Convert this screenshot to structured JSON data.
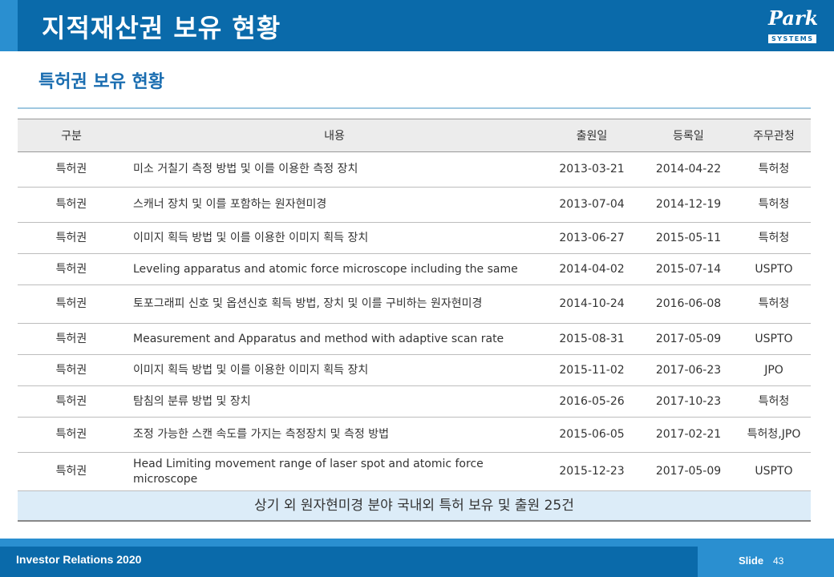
{
  "header": {
    "title": "지적재산권 보유 현황",
    "logo": {
      "word": "Park",
      "sub": "SYSTEMS"
    }
  },
  "section": {
    "title": "특허권 보유 현황"
  },
  "table": {
    "columns": [
      "구분",
      "내용",
      "출원일",
      "등록일",
      "주무관청"
    ],
    "rows": [
      {
        "type": "특허권",
        "content": "미소 거칠기 측정 방법 및 이를 이용한 측정 장치",
        "filed": "2013-03-21",
        "registered": "2014-04-22",
        "authority": "특허청"
      },
      {
        "type": "특허권",
        "content": "스캐너 장치 및 이를 포함하는 원자현미경",
        "filed": "2013-07-04",
        "registered": "2014-12-19",
        "authority": "특허청"
      },
      {
        "type": "특허권",
        "content": "이미지 획득 방법 및 이를 이용한 이미지 획득 장치",
        "filed": "2013-06-27",
        "registered": "2015-05-11",
        "authority": "특허청"
      },
      {
        "type": "특허권",
        "content": "Leveling apparatus and atomic force microscope including the same",
        "filed": "2014-04-02",
        "registered": "2015-07-14",
        "authority": "USPTO"
      },
      {
        "type": "특허권",
        "content": "토포그래피 신호 및 옵션신호 획득 방법, 장치 및 이를 구비하는 원자현미경",
        "filed": "2014-10-24",
        "registered": "2016-06-08",
        "authority": "특허청"
      },
      {
        "type": "특허권",
        "content": "Measurement and Apparatus and method with adaptive scan rate",
        "filed": "2015-08-31",
        "registered": "2017-05-09",
        "authority": "USPTO"
      },
      {
        "type": "특허권",
        "content": "이미지 획득 방법 및 이를 이용한 이미지 획득 장치",
        "filed": "2015-11-02",
        "registered": "2017-06-23",
        "authority": "JPO"
      },
      {
        "type": "특허권",
        "content": "탐침의 분류 방법 및 장치",
        "filed": "2016-05-26",
        "registered": "2017-10-23",
        "authority": "특허청"
      },
      {
        "type": "특허권",
        "content": "조정 가능한 스캔 속도를 가지는 측정장치 및 측정 방법",
        "filed": "2015-06-05",
        "registered": "2017-02-21",
        "authority": "특허청,JPO"
      },
      {
        "type": "특허권",
        "content": "Head Limiting movement range of laser spot and atomic force microscope",
        "filed": "2015-12-23",
        "registered": "2017-05-09",
        "authority": "USPTO"
      }
    ],
    "summary": "상기 외 원자현미경 분야 국내외 특허 보유 및 출원 25건"
  },
  "footer": {
    "left": "Investor Relations 2020",
    "slide_label": "Slide",
    "slide_number": "43"
  },
  "colors": {
    "header_blue": "#0a6aaa",
    "accent_blue": "#2a8fd0",
    "subtitle_blue": "#1a6db0",
    "summary_bg": "#dcecf8"
  }
}
